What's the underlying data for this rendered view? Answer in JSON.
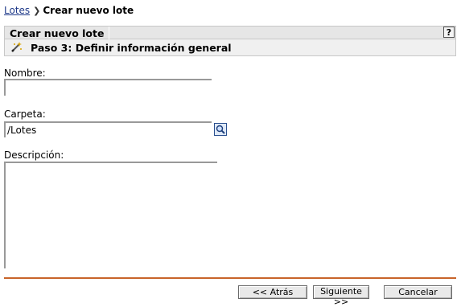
{
  "breadcrumb": {
    "link": "Lotes",
    "current": "Crear nuevo lote"
  },
  "header": {
    "title": "Crear nuevo lote",
    "help_label": "?"
  },
  "step": {
    "title": "Paso 3: Definir información general",
    "icon": "wizard-wand-icon"
  },
  "form": {
    "nombre_label": "Nombre:",
    "nombre_value": "",
    "carpeta_label": "Carpeta:",
    "carpeta_value": "/Lotes",
    "descripcion_label": "Descripción:",
    "descripcion_value": "",
    "browse_icon": "magnifier-icon"
  },
  "buttons": {
    "back": "<< Atrás",
    "next": "Siguiente >>",
    "cancel": "Cancelar"
  },
  "colors": {
    "divider": "#c8642a",
    "link": "#1f3a8a",
    "header_bg": "#e6e6e6"
  }
}
